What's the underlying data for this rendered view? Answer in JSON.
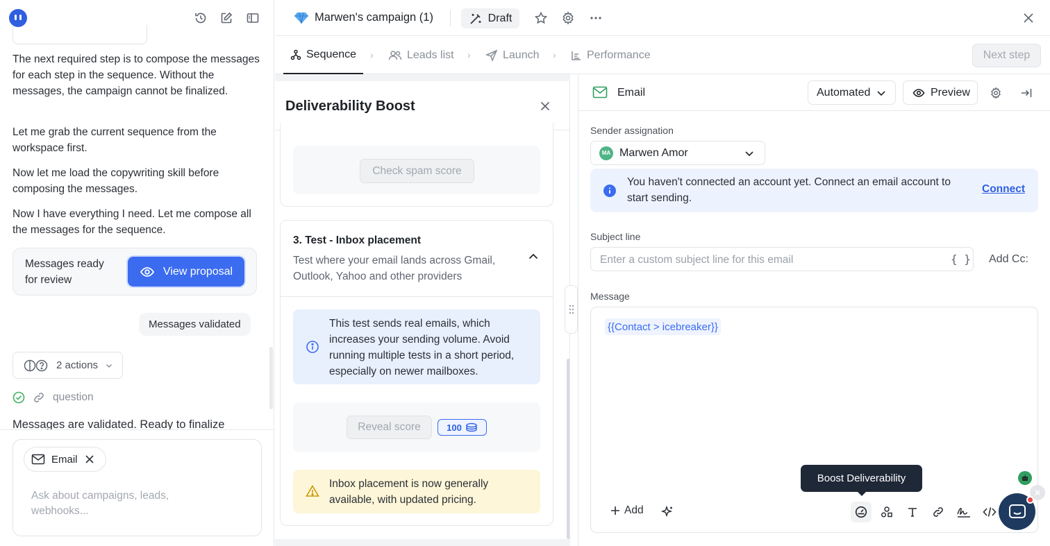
{
  "chat": {
    "messages": [
      "The next required step is to compose the messages for each step in the sequence. Without the messages, the campaign cannot be finalized.",
      "Let me grab the current sequence from the workspace first.",
      "Now let me load the copywriting skill before composing the messages.",
      "Now I have everything I need. Let me compose all the messages for the sequence."
    ],
    "ready_text": "Messages ready for review",
    "view_proposal": "View proposal",
    "validated": "Messages validated",
    "actions_label": "2 actions",
    "question_label": "question",
    "validated_msg": "Messages are validated. Ready to finalize",
    "composer_chip": "Email",
    "composer_placeholder": "Ask about campaigns, leads, webhooks..."
  },
  "header": {
    "campaign_title": "Marwen's campaign (1)",
    "status": "Draft"
  },
  "steps": {
    "items": [
      "Sequence",
      "Leads list",
      "Launch",
      "Performance"
    ],
    "next_step": "Next step"
  },
  "boost": {
    "title": "Deliverability Boost",
    "check_spam": "Check spam score",
    "section3_title": "3. Test - Inbox placement",
    "section3_desc": "Test where your email lands across Gmail, Outlook, Yahoo and other providers",
    "info_text": "This test sends real emails, which increases your sending volume. Avoid running multiple tests in a short period, especially on newer mailboxes.",
    "reveal_score": "Reveal score",
    "credits": "100",
    "warn_text": "Inbox placement is now generally available, with updated pricing."
  },
  "email": {
    "title": "Email",
    "mode": "Automated",
    "preview": "Preview",
    "sender_label": "Sender assignation",
    "sender_initials": "MA",
    "sender_name": "Marwen Amor",
    "alert_text": "You haven't connected an account yet. Connect an email account to start sending.",
    "connect": "Connect",
    "subject_label": "Subject line",
    "subject_placeholder": "Enter a custom subject line for this email",
    "add_cc": "Add Cc:",
    "message_label": "Message",
    "variable": "{{Contact > icebreaker}}",
    "add": "Add",
    "tooltip": "Boost Deliverability"
  },
  "colors": {
    "accent": "#3b6cf0",
    "tooltip_bg": "#1f2837",
    "info_bg": "#e8f0fe",
    "warn_bg": "#fdf6d8"
  }
}
